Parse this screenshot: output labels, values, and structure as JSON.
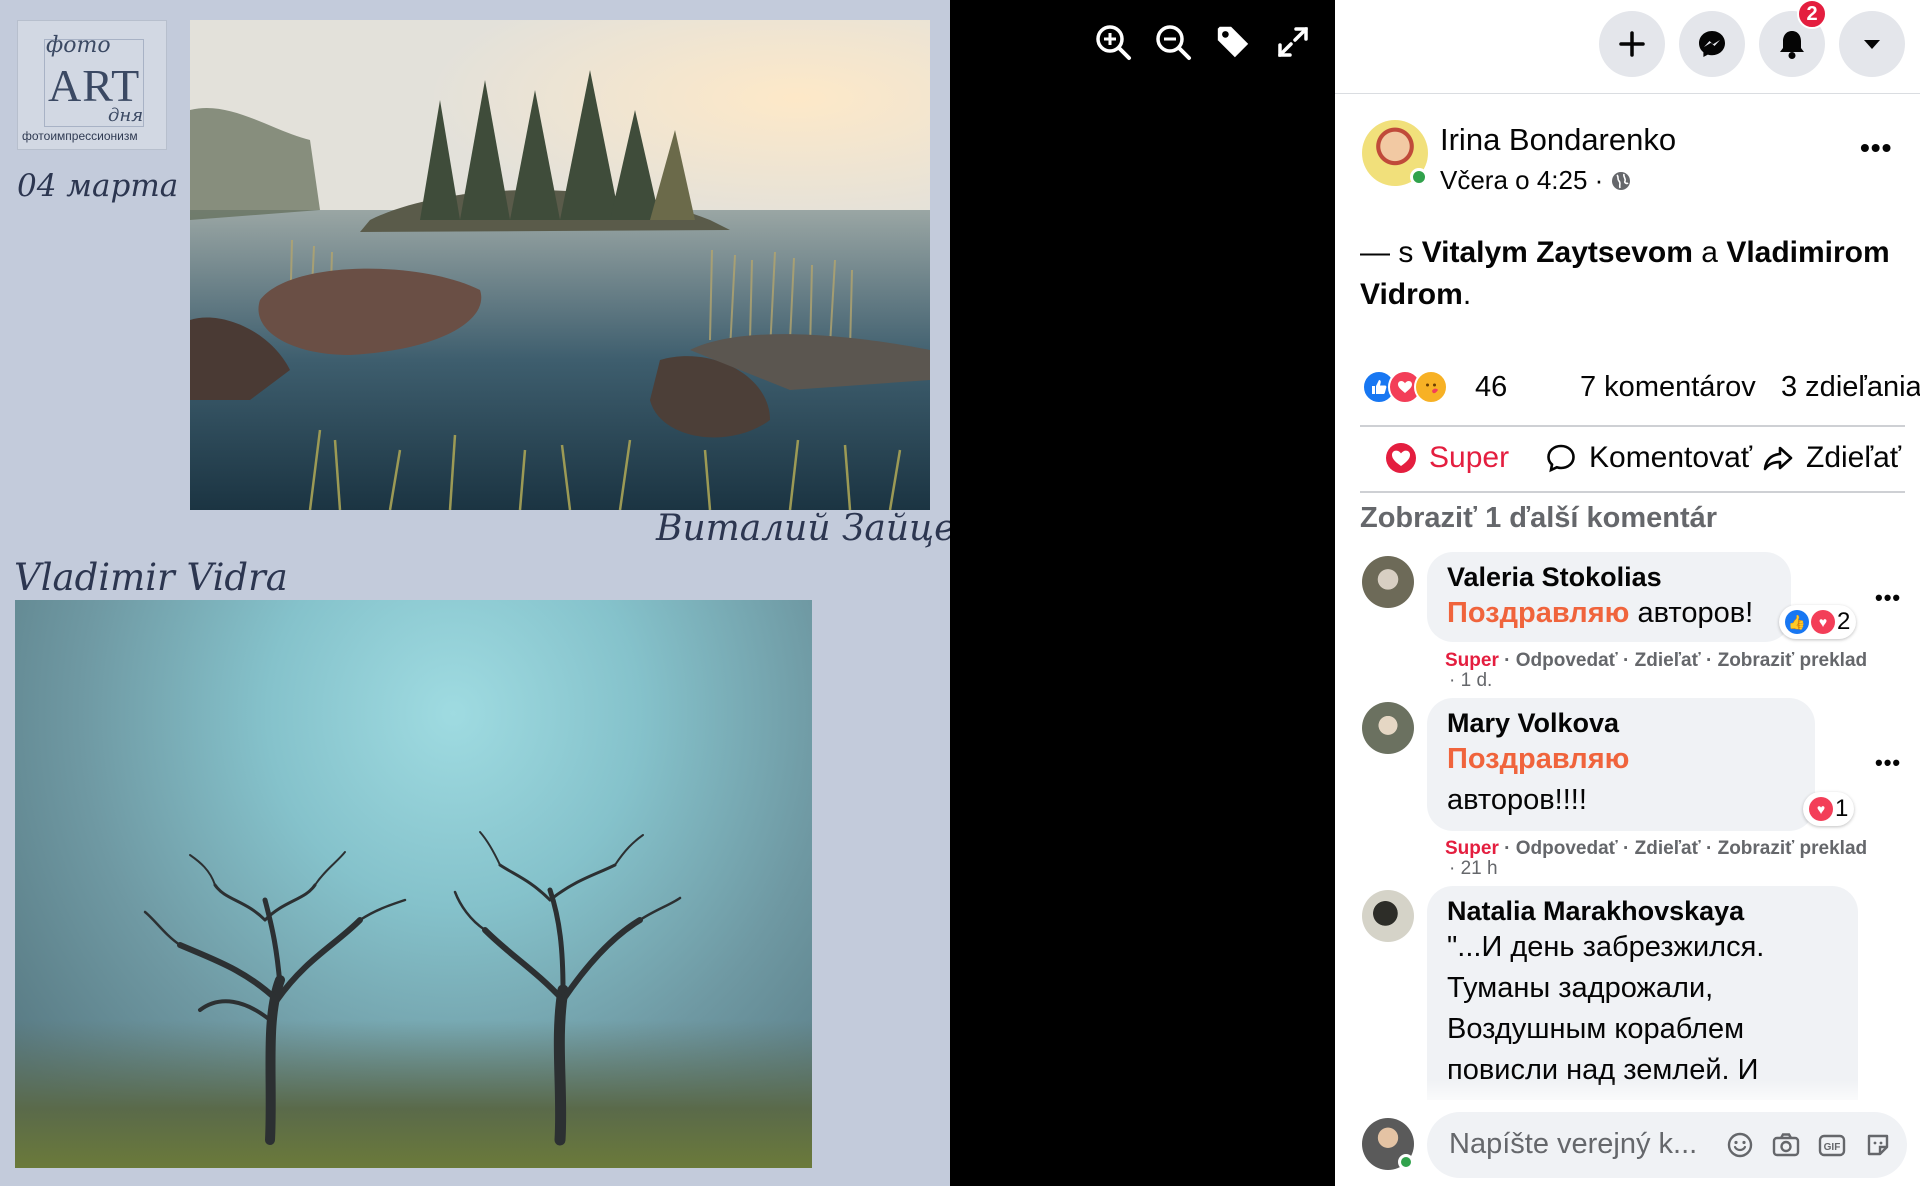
{
  "viewer": {
    "tools": [
      "zoom-in",
      "zoom-out",
      "tag",
      "fullscreen"
    ]
  },
  "poster": {
    "logo_line1": "фото",
    "logo_line2": "ART",
    "logo_line3": "дня",
    "logo_line4": "фотоимпрессионизм",
    "date": "04 марта",
    "caption_top": "Виталий Зайцев",
    "caption_bottom": "Vladimir Vidra"
  },
  "topbar": {
    "notification_count": "2"
  },
  "post": {
    "author": "Irina Bondarenko",
    "time": "Včera o 4:25 ·",
    "text_prefix": "— s",
    "tag1": "Vitalym Zaytsevom",
    "text_and": "a",
    "tag2": "Vladimirom Vidrom",
    "text_suffix": ".",
    "reaction_count": "46",
    "comments": "7 komentárov",
    "shares": "3 zdieľania"
  },
  "actions": {
    "super": "Super",
    "comment": "Komentovať",
    "share": "Zdieľať"
  },
  "more_comments": "Zobraziť 1 ďalší komentár",
  "comments": [
    {
      "name": "Valeria Stokolias",
      "highlight": "Поздравляю",
      "text": "авторов!",
      "reaction_count": "2",
      "meta_super": "Super",
      "meta_reply": "Odpovedať",
      "meta_share": "Zdieľať",
      "meta_translate": "Zobraziť preklad",
      "time": "· 1 d."
    },
    {
      "name": "Mary Volkova",
      "highlight": "Поздравляю",
      "text": "авторов!!!!",
      "reaction_count": "1",
      "meta_super": "Super",
      "meta_reply": "Odpovedať",
      "meta_share": "Zdieľať",
      "meta_translate": "Zobraziť preklad",
      "time": "· 21 h"
    },
    {
      "name": "Natalia Marakhovskaya",
      "line1": "\"...И день забрезжился.",
      "line2": "Туманы задрожали,",
      "line3": "Воздушным кораблем",
      "line4": "повисли над землей. И"
    }
  ],
  "composer": {
    "placeholder": "Napíšte verejný k..."
  },
  "colors": {
    "accent_red": "#e41e3f",
    "highlight_orange": "#f0643c",
    "like_blue": "#1877f2",
    "poster_bg": "#c3cbdb"
  }
}
